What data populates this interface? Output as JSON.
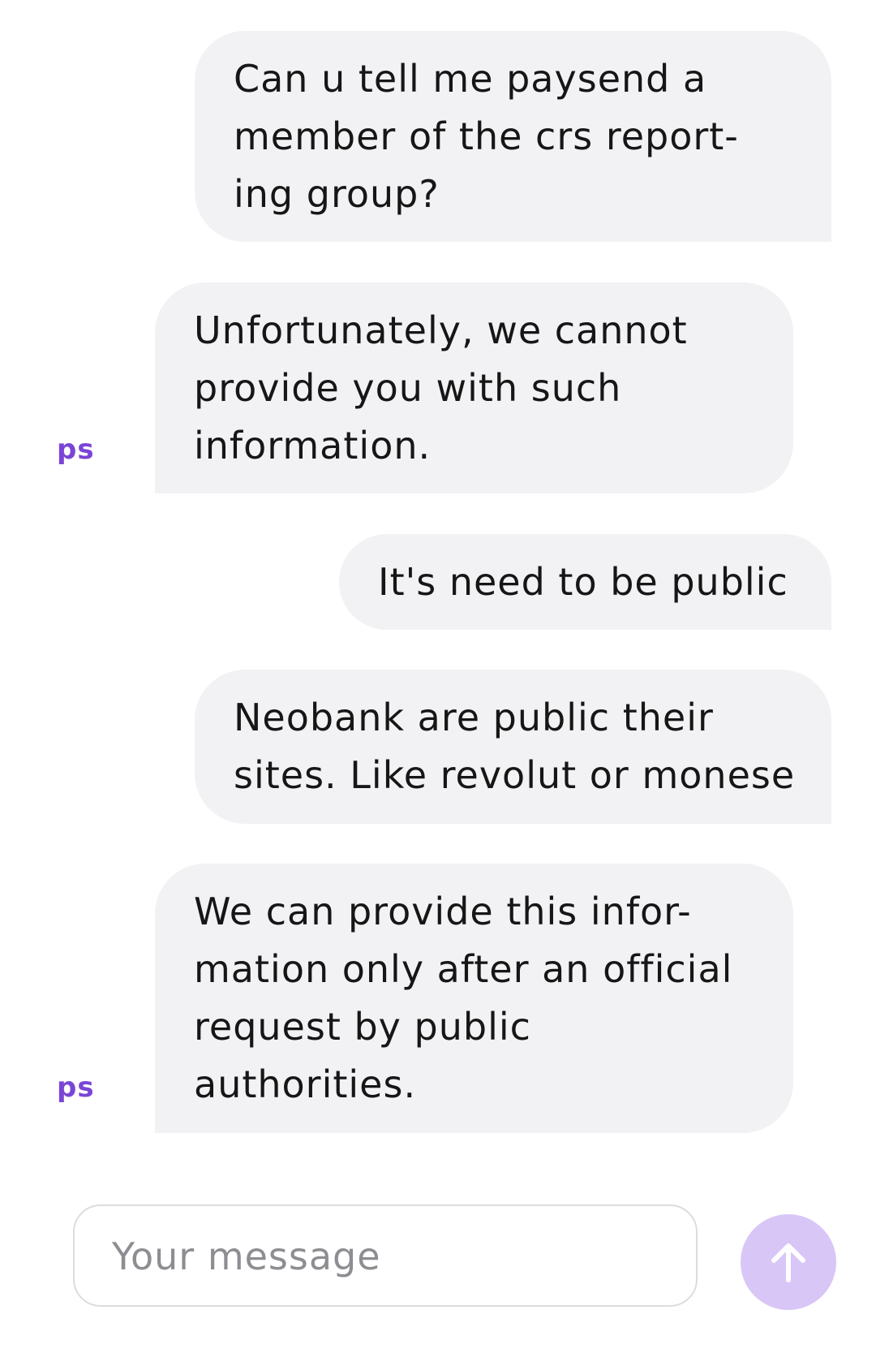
{
  "messages": [
    {
      "sender": "user",
      "text": "Can u tell me paysend a\nmember of the crs report-\ning group?"
    },
    {
      "sender": "agent",
      "avatar": "ps",
      "text": "Unfortunately, we cannot\nprovide you with such\ninformation."
    },
    {
      "sender": "user",
      "text": "It's need to be public"
    },
    {
      "sender": "user",
      "text": "Neobank are public their\nsites. Like revolut or monese"
    },
    {
      "sender": "agent",
      "avatar": "ps",
      "text": "We can provide this infor-\nmation only after an official\nrequest by public\nauthorities."
    }
  ],
  "composer": {
    "placeholder": "Your message",
    "send_icon": "arrow-up-icon"
  },
  "colors": {
    "bubble": "#f2f2f4",
    "avatar_text": "#7a45d6",
    "send_button": "#d8c6f7"
  }
}
